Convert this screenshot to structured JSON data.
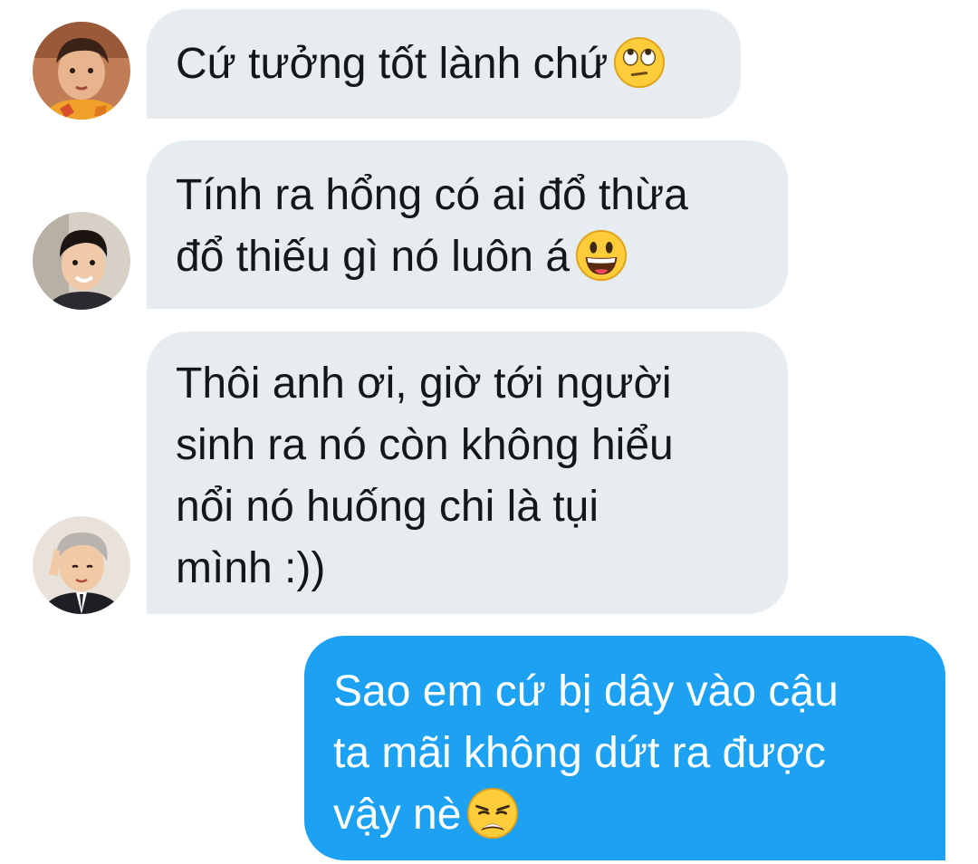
{
  "messages": [
    {
      "sender": "incoming",
      "avatar": "avatar-user-1",
      "lines": [
        "Cứ tưởng tốt lành chứ"
      ],
      "emoji": "face-with-rolling-eyes"
    },
    {
      "sender": "incoming",
      "avatar": "avatar-user-2",
      "lines": [
        "Tính ra hổng có ai đổ thừa",
        "đổ thiếu gì nó luôn á"
      ],
      "emoji": "grinning-face-with-big-eyes"
    },
    {
      "sender": "incoming",
      "avatar": "avatar-user-3",
      "lines": [
        "Thôi anh ơi, giờ tới người",
        "sinh ra nó còn không hiểu",
        "nổi nó huống chi là tụi",
        "mình :))"
      ]
    },
    {
      "sender": "outgoing",
      "lines": [
        "Sao em cứ bị dây vào cậu",
        "ta mãi không dứt ra được",
        "vậy nè"
      ],
      "emoji": "weary-face"
    }
  ],
  "colors": {
    "incoming_bubble": "#e6ecf0",
    "outgoing_bubble": "#1da1f2",
    "incoming_text": "#14171a",
    "outgoing_text": "#ffffff"
  }
}
